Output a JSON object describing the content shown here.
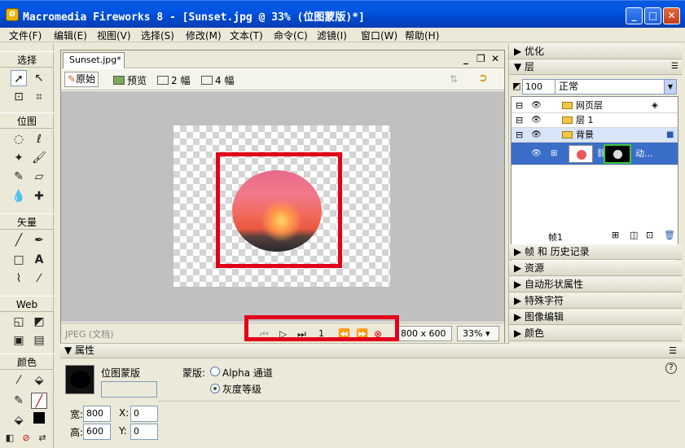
{
  "window": {
    "icon_text": "Ø",
    "title": "Macromedia Fireworks 8 - [Sunset.jpg @  33% (位图蒙版)*]",
    "min_btn": "_",
    "max_btn": "□",
    "close_btn": "✕"
  },
  "menu": [
    "文件(F)",
    "编辑(E)",
    "视图(V)",
    "选择(S)",
    "修改(M)",
    "文本(T)",
    "命令(C)",
    "滤镜(I)",
    "窗口(W)",
    "帮助(H)"
  ],
  "tools": {
    "sections": [
      "选择",
      "位图",
      "矢量",
      "Web",
      "颜色"
    ]
  },
  "document": {
    "tab_label": "Sunset.jpg*",
    "views": {
      "original": "原始",
      "preview": "预览",
      "two_up": "2 幅",
      "four_up": "4 幅"
    },
    "status_text": "JPEG (文档)",
    "frame_number": "1",
    "canvas_size": "800 x 600",
    "zoom": "33%"
  },
  "properties": {
    "header": "属性",
    "mask_name": "位图蒙版",
    "mask_label": "蒙版:",
    "option_alpha": "Alpha 通道",
    "option_gray": "灰度等级",
    "selected_option": "灰度等级",
    "width_label": "宽:",
    "width_value": "800",
    "height_label": "高:",
    "height_value": "600",
    "x_label": "X:",
    "x_value": "0",
    "y_label": "Y:",
    "y_value": "0",
    "help": "?"
  },
  "right_panels": {
    "optimize": "优化",
    "layers": "层",
    "opacity": "100",
    "blend_mode": "正常",
    "layer_rows": [
      {
        "name": "网页层"
      },
      {
        "name": "层 1"
      },
      {
        "name": "背景"
      },
      {
        "name": "动..."
      }
    ],
    "frame_label": "帧1",
    "collapsed": [
      "帧 和 历史记录",
      "资源",
      "自动形状属性",
      "特殊字符",
      "图像编辑",
      "颜色"
    ]
  }
}
